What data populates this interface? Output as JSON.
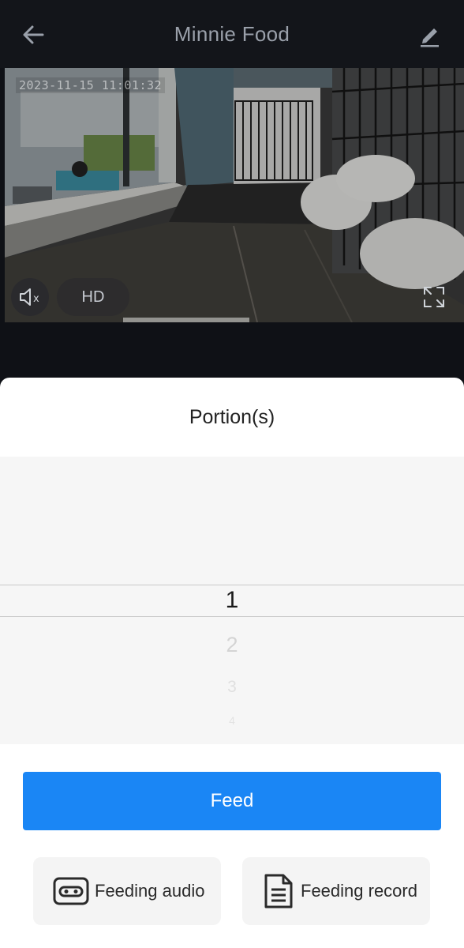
{
  "header": {
    "title": "Minnie Food"
  },
  "video": {
    "timestamp": "2023-11-15   11:01:32",
    "quality_label": "HD"
  },
  "sheet": {
    "title": "Portion(s)",
    "picker": {
      "selected": "1",
      "options": [
        "1",
        "2",
        "3",
        "4"
      ]
    }
  },
  "actions": {
    "feed_label": "Feed",
    "audio_label": "Feeding audio",
    "record_label": "Feeding record"
  },
  "colors": {
    "accent": "#1a86f5",
    "topbar": "#13151a"
  }
}
